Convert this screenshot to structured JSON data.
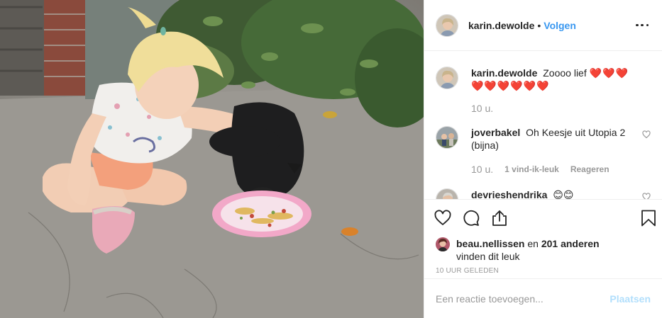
{
  "header": {
    "username": "karin.dewolde",
    "separator": "•",
    "follow_label": "Volgen"
  },
  "comments": [
    {
      "username": "karin.dewolde",
      "text": "Zoooo lief",
      "emoji": "❤️❤️❤️❤️❤️❤️❤️❤️❤️",
      "time": "10 u."
    },
    {
      "username": "joverbakel",
      "text": "Oh Keesje uit Utopia 2 (bijna)",
      "time": "10 u.",
      "likes": "1 vind-ik-leuk",
      "reply": "Reageren"
    },
    {
      "username": "devrieshendrika",
      "text": "😊😊"
    }
  ],
  "likes": {
    "user": "beau.nellissen",
    "connector": "en",
    "others": "201 anderen",
    "suffix": "vinden dit leuk"
  },
  "timestamp": "10 UUR GELEDEN",
  "add_comment": {
    "placeholder": "Een reactie toevoegen...",
    "post_label": "Plaatsen"
  },
  "colors": {
    "accent": "#3897f0",
    "post_disabled": "#b2dffc",
    "muted": "#999999",
    "text": "#262626"
  },
  "icons": [
    "heart-icon",
    "comment-icon",
    "share-icon",
    "bookmark-icon",
    "more-icon",
    "like-comment-icon"
  ]
}
